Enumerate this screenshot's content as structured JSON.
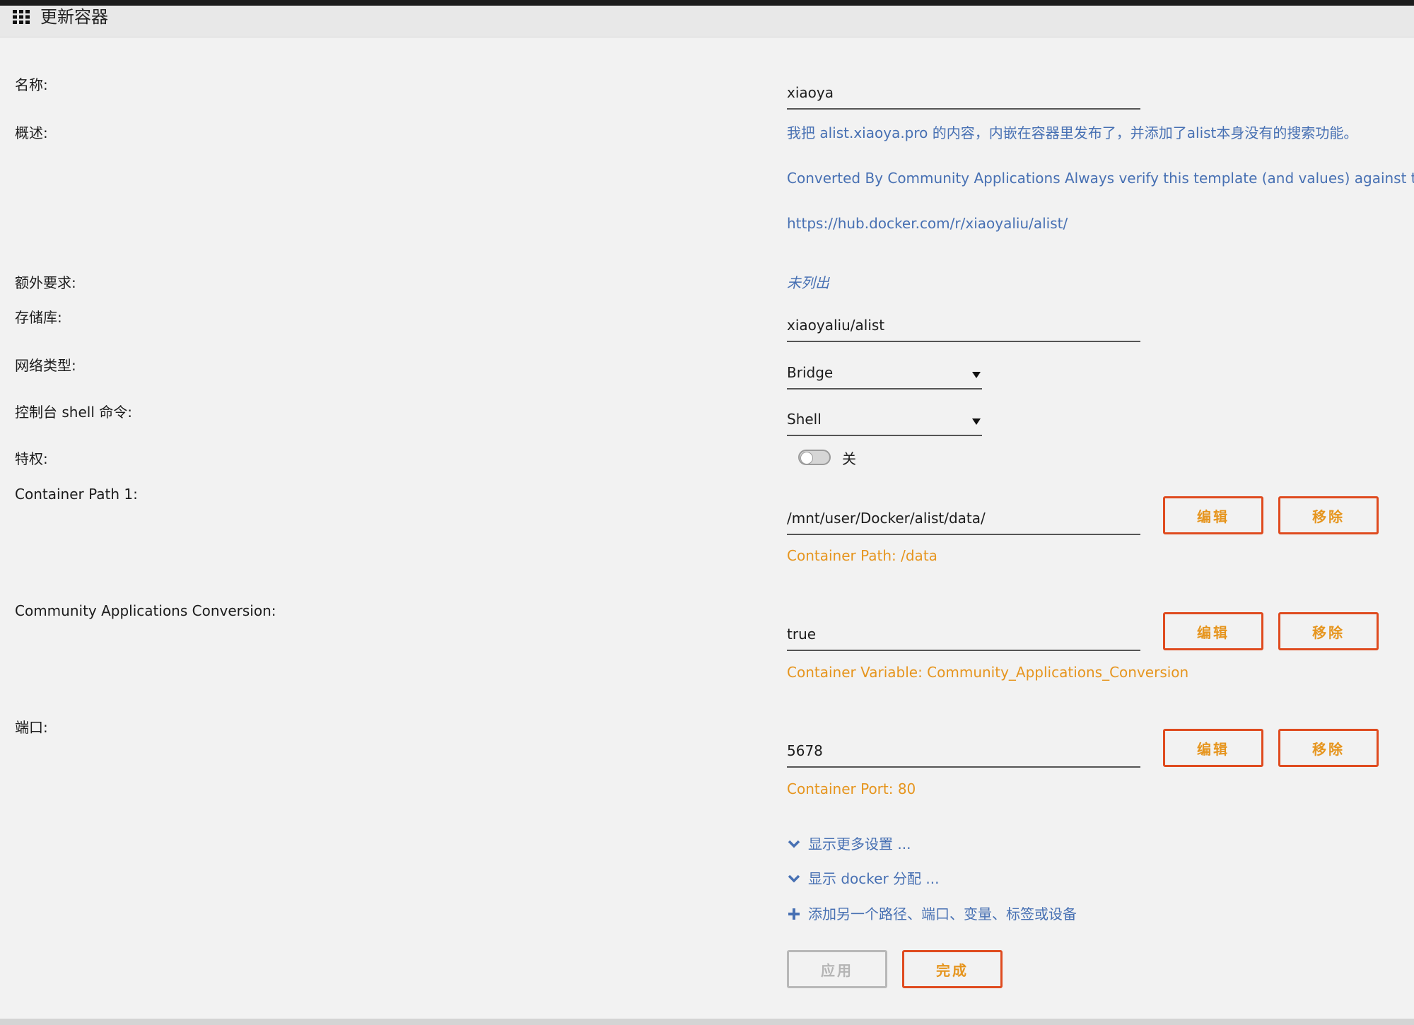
{
  "header": {
    "title": "更新容器",
    "icon": "grid-icon"
  },
  "form": {
    "name": {
      "label": "名称:",
      "value": "xiaoya"
    },
    "overview": {
      "label": "概述:",
      "line1": "我把 alist.xiaoya.pro 的内容，内嵌在容器里发布了，并添加了alist本身没有的搜索功能。",
      "line2": "Converted By Community Applications Always verify this template (and values) against the s",
      "line3": "https://hub.docker.com/r/xiaoyaliu/alist/"
    },
    "extra": {
      "label": "额外要求:",
      "value": "未列出"
    },
    "repository": {
      "label": "存储库:",
      "value": "xiaoyaliu/alist"
    },
    "network": {
      "label": "网络类型:",
      "value": "Bridge"
    },
    "console": {
      "label": "控制台 shell 命令:",
      "value": "Shell"
    },
    "privileged": {
      "label": "特权:",
      "state": "关"
    },
    "container_path": {
      "label": "Container Path 1:",
      "value": "/mnt/user/Docker/alist/data/",
      "hint": "Container Path: /data",
      "edit_label": "编辑",
      "remove_label": "移除"
    },
    "ca_conversion": {
      "label": "Community Applications Conversion:",
      "value": "true",
      "hint": "Container Variable: Community_Applications_Conversion",
      "edit_label": "编辑",
      "remove_label": "移除"
    },
    "port": {
      "label": "端口:",
      "value": "5678",
      "hint": "Container Port: 80",
      "edit_label": "编辑",
      "remove_label": "移除"
    }
  },
  "links": {
    "more_settings": "显示更多设置 ...",
    "docker_allocation": "显示 docker 分配 ...",
    "add_another": "添加另一个路径、端口、变量、标签或设备"
  },
  "actions": {
    "apply_label": "应用",
    "done_label": "完成"
  },
  "colors": {
    "link_blue": "#4770b3",
    "hint_orange": "#e6951e",
    "button_border": "#df4b1f"
  }
}
